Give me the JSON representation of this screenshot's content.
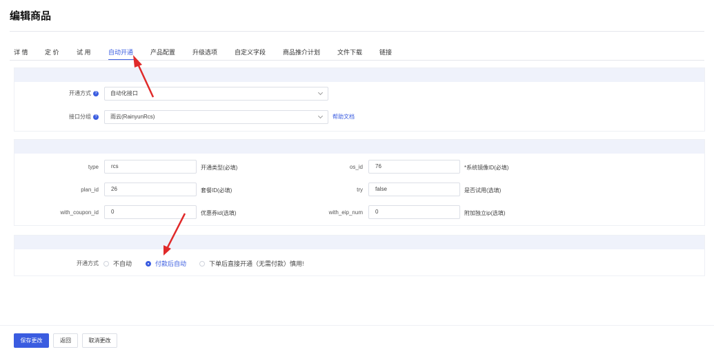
{
  "page": {
    "title": "编辑商品"
  },
  "tabs": [
    {
      "label": "详 情"
    },
    {
      "label": "定 价"
    },
    {
      "label": "试 用"
    },
    {
      "label": "自动开通"
    },
    {
      "label": "产品配置"
    },
    {
      "label": "升级选项"
    },
    {
      "label": "自定义字段"
    },
    {
      "label": "商品推介计划"
    },
    {
      "label": "文件下载"
    },
    {
      "label": "链接"
    }
  ],
  "active_tab": "自动开通",
  "provision": {
    "method_label": "开通方式",
    "method_value": "自动化接口",
    "group_label": "接口分组",
    "group_value": "雨云(RainyunRcs)",
    "help_link": "帮助文档"
  },
  "params": {
    "type_label": "type",
    "type_value": "rcs",
    "type_hint": "开通类型(必填)",
    "plan_label": "plan_id",
    "plan_value": "26",
    "plan_hint": "套餐ID(必填)",
    "coupon_label": "with_coupon_id",
    "coupon_value": "0",
    "coupon_hint": "优惠券id(选填)",
    "os_label": "os_id",
    "os_value": "76",
    "os_hint": "*系统镜像ID(必填)",
    "try_label": "try",
    "try_value": "false",
    "try_hint": "是否试用(选填)",
    "eip_label": "with_eip_num",
    "eip_value": "0",
    "eip_hint": "附加独立ip(选填)"
  },
  "open_mode": {
    "label": "开通方式",
    "options": [
      "不自动",
      "付款后自动",
      "下单后直接开通（无需付款）慎用!"
    ],
    "selected": "付款后自动"
  },
  "footer": {
    "save": "保存更改",
    "back": "返回",
    "cancel": "取消更改"
  },
  "colors": {
    "accent": "#3a5ce0",
    "annotation_arrow": "#e02a2a",
    "panel_header": "#eff2fb"
  }
}
